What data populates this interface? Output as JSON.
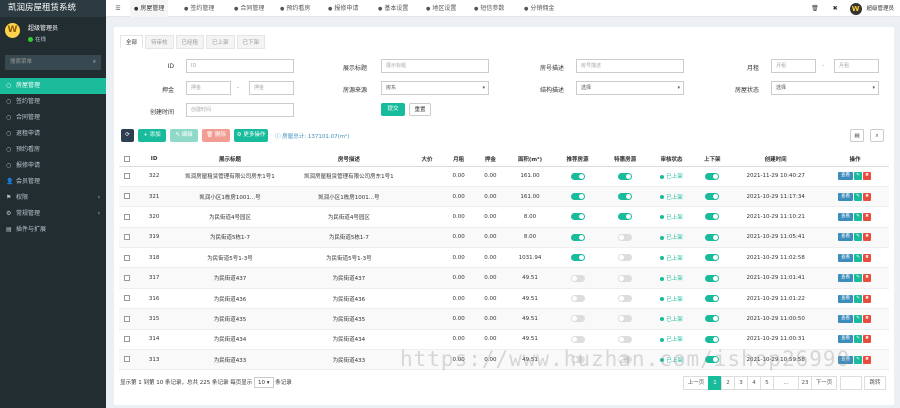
{
  "app_title": "凯润房屋租赁系统",
  "user": {
    "name": "超级管理员",
    "status": "在线",
    "avatar_letter": "W"
  },
  "search_placeholder": "搜索菜单",
  "menu": [
    {
      "label": "房屋管理",
      "icon": "circle-icon",
      "active": true
    },
    {
      "label": "签约管理",
      "icon": "circle-icon"
    },
    {
      "label": "合同管理",
      "icon": "circle-icon"
    },
    {
      "label": "退租申请",
      "icon": "circle-icon"
    },
    {
      "label": "预约看房",
      "icon": "circle-icon"
    },
    {
      "label": "报修申请",
      "icon": "circle-icon"
    },
    {
      "label": "会员管理",
      "icon": "user-icon"
    },
    {
      "label": "权限",
      "icon": "users-icon",
      "caret": true
    },
    {
      "label": "常规管理",
      "icon": "gear-icon",
      "caret": true
    },
    {
      "label": "插件与扩展",
      "icon": "puzzle-icon"
    }
  ],
  "top_tabs": [
    {
      "label": "房屋管理",
      "active": true
    },
    {
      "label": "签约管理"
    },
    {
      "label": "合同管理"
    },
    {
      "label": "预约看房"
    },
    {
      "label": "报修申请"
    },
    {
      "label": "基本设置"
    },
    {
      "label": "地区设置"
    },
    {
      "label": "短信参数"
    },
    {
      "label": "分销佣金"
    }
  ],
  "top_user": "超级管理员",
  "status_tabs": [
    "全部",
    "待审核",
    "已经租",
    "已上架",
    "已下架"
  ],
  "filters": {
    "id": {
      "label": "ID",
      "placeholder": "ID"
    },
    "title": {
      "label": "展示标题",
      "placeholder": "展示标题"
    },
    "room_no": {
      "label": "房号描述",
      "placeholder": "房号描述"
    },
    "rent": {
      "label": "月租",
      "placeholder1": "月租",
      "placeholder2": "月租"
    },
    "deposit": {
      "label": "押金",
      "placeholder1": "押金",
      "placeholder2": "押金"
    },
    "src": {
      "label": "房源来源",
      "value": "房东"
    },
    "category": {
      "label": "结构描述",
      "value": "选择"
    },
    "state": {
      "label": "房屋状态",
      "value": "选择"
    },
    "created": {
      "label": "创建时间",
      "placeholder": "创建时间"
    }
  },
  "btn_submit": "提交",
  "btn_reset": "重置",
  "toolbar": {
    "add": "添加",
    "edit": "编辑",
    "del": "删除",
    "more": "更多操作"
  },
  "summary": "房屋总计: 137101.07(m²)",
  "columns": [
    "ID",
    "展示标题",
    "房号描述",
    "大价",
    "月租",
    "押金",
    "面积(m²)",
    "推荐房源",
    "特惠房源",
    "审核状态",
    "上下架",
    "创建时间",
    "操作"
  ],
  "rows": [
    {
      "id": "322",
      "title": "凯润房屋租赁管理有限公司房东1号1",
      "room": "凯润房屋租赁管理有限公司房东1号1",
      "price": "",
      "rent": "0.00",
      "deposit": "0.00",
      "area": "161.00",
      "rec": true,
      "spec": true,
      "status": "已上架",
      "shelf": true,
      "time": "2021-11-29 10:40:27"
    },
    {
      "id": "321",
      "title": "凯润小区1栋房1001...号",
      "room": "凯润小区1栋房1001...号",
      "price": "",
      "rent": "0.00",
      "deposit": "0.00",
      "area": "161.00",
      "rec": true,
      "spec": true,
      "status": "已上架",
      "shelf": true,
      "time": "2021-10-29 11:17:34"
    },
    {
      "id": "320",
      "title": "为民街道4号园区",
      "room": "为民街道4号园区",
      "price": "",
      "rent": "0.00",
      "deposit": "0.00",
      "area": "8.00",
      "rec": true,
      "spec": true,
      "status": "已上架",
      "shelf": true,
      "time": "2021-10-29 11:10:21"
    },
    {
      "id": "319",
      "title": "为民街道5栋1-7",
      "room": "为民街道5栋1-7",
      "price": "",
      "rent": "0.00",
      "deposit": "0.00",
      "area": "8.00",
      "rec": true,
      "spec": false,
      "status": "已上架",
      "shelf": true,
      "time": "2021-10-29 11:05:41"
    },
    {
      "id": "318",
      "title": "为民街道5号1-3号",
      "room": "为民街道5号1-3号",
      "price": "",
      "rent": "0.00",
      "deposit": "0.00",
      "area": "1031.94",
      "rec": true,
      "spec": false,
      "status": "已上架",
      "shelf": true,
      "time": "2021-10-29 11:02:58"
    },
    {
      "id": "317",
      "title": "为民街道437",
      "room": "为民街道437",
      "price": "",
      "rent": "0.00",
      "deposit": "0.00",
      "area": "49.51",
      "rec": false,
      "spec": false,
      "status": "已上架",
      "shelf": true,
      "time": "2021-10-29 11:01:41"
    },
    {
      "id": "316",
      "title": "为民街道436",
      "room": "为民街道436",
      "price": "",
      "rent": "0.00",
      "deposit": "0.00",
      "area": "49.51",
      "rec": false,
      "spec": false,
      "status": "已上架",
      "shelf": true,
      "time": "2021-10-29 11:01:22"
    },
    {
      "id": "315",
      "title": "为民街道435",
      "room": "为民街道435",
      "price": "",
      "rent": "0.00",
      "deposit": "0.00",
      "area": "49.51",
      "rec": false,
      "spec": false,
      "status": "已上架",
      "shelf": true,
      "time": "2021-10-29 11:00:50"
    },
    {
      "id": "314",
      "title": "为民街道434",
      "room": "为民街道434",
      "price": "",
      "rent": "0.00",
      "deposit": "0.00",
      "area": "49.51",
      "rec": false,
      "spec": false,
      "status": "已上架",
      "shelf": true,
      "time": "2021-10-29 11:00:31"
    },
    {
      "id": "313",
      "title": "为民街道433",
      "room": "为民街道433",
      "price": "",
      "rent": "0.00",
      "deposit": "0.00",
      "area": "49.51",
      "rec": false,
      "spec": false,
      "status": "已上架",
      "shelf": true,
      "time": "2021-10-29 10:59:58"
    }
  ],
  "op_labels": {
    "view": "查看"
  },
  "footer": {
    "text1": "显示第 1 到第 10 条记录，总共 225 条记录 每页显示",
    "page_size": "10",
    "text2": "条记录"
  },
  "pager": [
    "上一页",
    "1",
    "2",
    "3",
    "4",
    "5",
    "...",
    "23",
    "下一页"
  ],
  "pager_go": "跳转",
  "watermark": "https://www.huzhan.com/ishop26990"
}
